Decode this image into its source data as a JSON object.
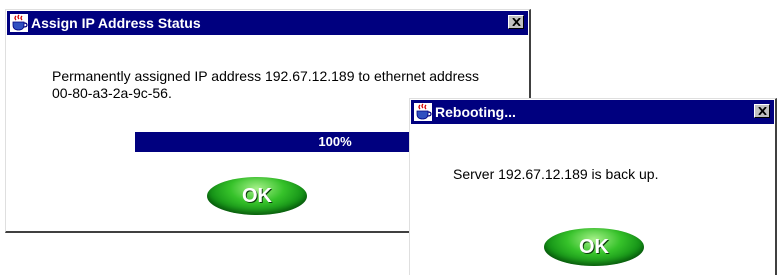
{
  "assign_dialog": {
    "title": "Assign IP Address Status",
    "message": "Permanently assigned IP address 192.67.12.189 to ethernet address 00-80-a3-2a-9c-56.",
    "progress": {
      "value": 1.0,
      "label": "100%"
    },
    "ok_label": "OK"
  },
  "reboot_dialog": {
    "title": "Rebooting...",
    "message": "Server 192.67.12.189 is back up.",
    "ok_label": "OK"
  },
  "icons": {
    "app": "java-cup-icon",
    "close": "close-icon"
  },
  "colors": {
    "titlebar": "#00007f",
    "progress_fill": "#00007f",
    "ok_button": "#1ea820",
    "background": "#ffffff"
  }
}
